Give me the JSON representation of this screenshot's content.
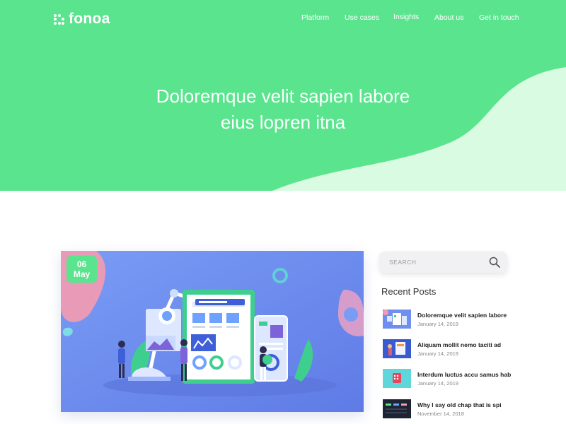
{
  "brand": {
    "name": "fonoa"
  },
  "nav": {
    "items": [
      {
        "label": "Platform"
      },
      {
        "label": "Use cases"
      },
      {
        "label": "Insights"
      },
      {
        "label": "About us"
      },
      {
        "label": "Get in touch"
      }
    ]
  },
  "hero": {
    "title_line1": "Doloremque velit sapien labore",
    "title_line2": "eius lopren itna"
  },
  "featured": {
    "day": "06",
    "month": "May"
  },
  "sidebar": {
    "search_placeholder": "SEARCH",
    "recent_title": "Recent Posts",
    "posts": [
      {
        "title": "Doloremque velit sapien labore",
        "date": "January 14, 2019"
      },
      {
        "title": "Aliquam mollit nemo taciti ad",
        "date": "January 14, 2019"
      },
      {
        "title": "Interdum luctus accu samus hab",
        "date": "January 14, 2019"
      },
      {
        "title": "Why I say old chap that is spi",
        "date": "November 14, 2018"
      }
    ]
  },
  "colors": {
    "brand_green": "#5be48e",
    "light_green": "#d8fbe2",
    "card_blue": "#6f8ef0"
  }
}
